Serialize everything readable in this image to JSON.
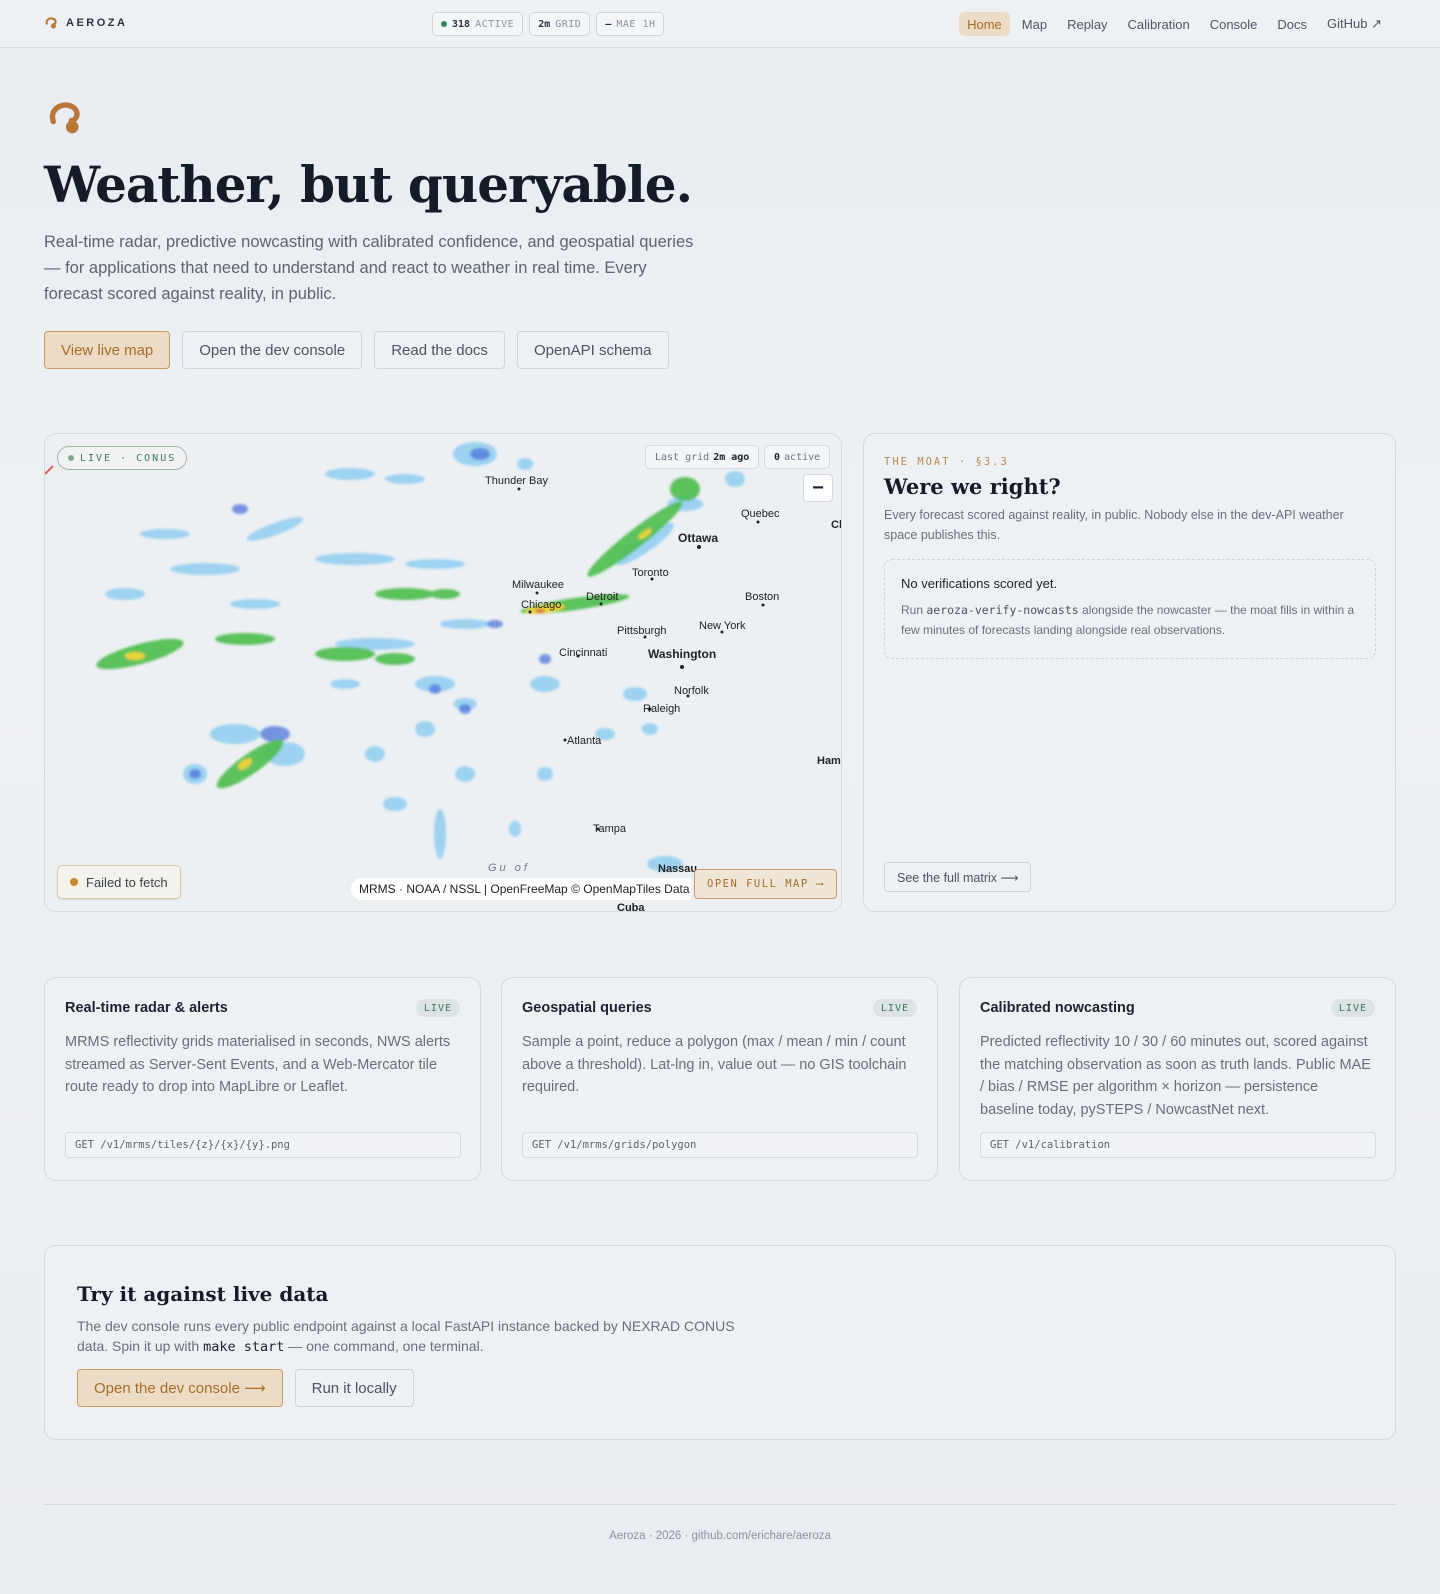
{
  "nav": {
    "brand": "AEROZA",
    "pills": [
      {
        "value": "318",
        "label": "ACTIVE"
      },
      {
        "value": "2m",
        "label": "GRID"
      },
      {
        "value": "–",
        "label": "MAE 1H"
      }
    ],
    "links": [
      "Home",
      "Map",
      "Replay",
      "Calibration",
      "Console",
      "Docs",
      "GitHub ↗"
    ],
    "active": "Home"
  },
  "hero": {
    "title": "Weather, but queryable.",
    "subtitle": "Real-time radar, predictive nowcasting with calibrated confidence, and geospatial queries — for applications that need to understand and react to weather in real time. Every forecast scored against reality, in public.",
    "buttons": [
      "View live map",
      "Open the dev console",
      "Read the docs",
      "OpenAPI schema"
    ]
  },
  "map": {
    "badge": "LIVE · CONUS",
    "last_grid_label": "Last grid",
    "last_grid_value": "2m ago",
    "active_value": "0",
    "active_label": "active",
    "zoom_in": "+",
    "zoom_out": "−",
    "error": "Failed to fetch",
    "attribution": "MRMS · NOAA / NSSL | OpenFreeMap © OpenMapTiles Data from OpenStreetMap",
    "open_full": "OPEN FULL MAP ⟶",
    "cities": [
      "Thunder Bay",
      "Quebec",
      "Ch",
      "Ottawa",
      "Toronto",
      "Milwaukee",
      "Detroit",
      "Chicago",
      "Boston",
      "Pittsburgh",
      "New York",
      "Cincinnati",
      "Washington",
      "Norfolk",
      "Raleigh",
      "Atlanta",
      "Ham",
      "Tampa",
      "Nassau",
      "Cuba",
      "Gu  of"
    ],
    "colors": {
      "precip_light": "#7fc4ea",
      "precip_mid": "#4f73d9",
      "precip_green": "#4cbd4c",
      "precip_yellow": "#e8d33a"
    }
  },
  "moat": {
    "kicker": "THE MOAT · §3.3",
    "title": "Were we right?",
    "desc": "Every forecast scored against reality, in public. Nobody else in the dev-API weather space publishes this.",
    "empty_title": "No verifications scored yet.",
    "empty_pre": "Run ",
    "empty_code": "aeroza-verify-nowcasts",
    "empty_post": " alongside the nowcaster — the moat fills in within a few minutes of forecasts landing alongside real observations.",
    "button": "See the full matrix ⟶"
  },
  "features": [
    {
      "title": "Real-time radar & alerts",
      "badge": "LIVE",
      "body": "MRMS reflectivity grids materialised in seconds, NWS alerts streamed as Server-Sent Events, and a Web-Mercator tile route ready to drop into MapLibre or Leaflet.",
      "code": "GET /v1/mrms/tiles/{z}/{x}/{y}.png"
    },
    {
      "title": "Geospatial queries",
      "badge": "LIVE",
      "body": "Sample a point, reduce a polygon (max / mean / min / count above a threshold). Lat-lng in, value out — no GIS toolchain required.",
      "code": "GET /v1/mrms/grids/polygon"
    },
    {
      "title": "Calibrated nowcasting",
      "badge": "LIVE",
      "body": "Predicted reflectivity 10 / 30 / 60 minutes out, scored against the matching observation as soon as truth lands. Public MAE / bias / RMSE per algorithm × horizon — persistence baseline today, pySTEPS / NowcastNet next.",
      "code": "GET /v1/calibration"
    }
  ],
  "cta": {
    "title": "Try it against live data",
    "body_pre": "The dev console runs every public endpoint against a local FastAPI instance backed by NEXRAD CONUS data. Spin it up with ",
    "body_code": "make start",
    "body_post": " — one command, one terminal.",
    "primary": "Open the dev console ⟶",
    "secondary": "Run it locally"
  },
  "footer": "Aeroza · 2026 · github.com/erichare/aeroza",
  "accent": "#a86d2a"
}
